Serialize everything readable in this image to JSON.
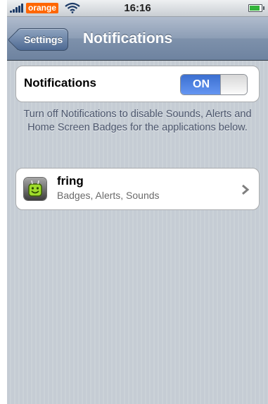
{
  "status_bar": {
    "carrier": "orange",
    "time": "16:16",
    "icons": [
      "signal-icon",
      "wifi-icon",
      "battery-icon"
    ],
    "carrier_color": "#ff6600"
  },
  "nav": {
    "back_label": "Settings",
    "title": "Notifications"
  },
  "notifications": {
    "label": "Notifications",
    "toggle_state": "ON",
    "toggle_color": "#3b6fd0"
  },
  "hint": "Turn off Notifications to disable Sounds, Alerts and Home Screen Badges for the applications below.",
  "apps": [
    {
      "name": "fring",
      "subtitle": "Badges, Alerts, Sounds",
      "icon": "fring-app-icon"
    }
  ]
}
